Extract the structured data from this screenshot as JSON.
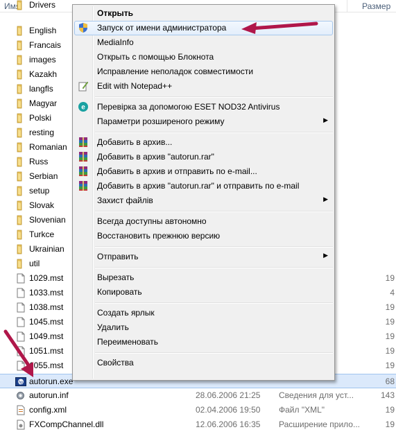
{
  "header": {
    "name_col": "Имя",
    "size_col": "Размер"
  },
  "files": [
    {
      "name": "Drivers",
      "kind": "folder",
      "date": "",
      "type": "",
      "size": ""
    },
    {
      "name": "English",
      "kind": "folder",
      "date": "",
      "type": "",
      "size": ""
    },
    {
      "name": "Francais",
      "kind": "folder",
      "date": "",
      "type": "",
      "size": ""
    },
    {
      "name": "images",
      "kind": "folder",
      "date": "",
      "type": "",
      "size": ""
    },
    {
      "name": "Kazakh",
      "kind": "folder",
      "date": "",
      "type": "",
      "size": ""
    },
    {
      "name": "langfls",
      "kind": "folder",
      "date": "",
      "type": "",
      "size": ""
    },
    {
      "name": "Magyar",
      "kind": "folder",
      "date": "",
      "type": "",
      "size": ""
    },
    {
      "name": "Polski",
      "kind": "folder",
      "date": "",
      "type": "",
      "size": ""
    },
    {
      "name": "resting",
      "kind": "folder",
      "date": "",
      "type": "",
      "size": ""
    },
    {
      "name": "Romanian",
      "kind": "folder",
      "date": "",
      "type": "",
      "size": ""
    },
    {
      "name": "Russ",
      "kind": "folder",
      "date": "",
      "type": "",
      "size": ""
    },
    {
      "name": "Serbian",
      "kind": "folder",
      "date": "",
      "type": "",
      "size": ""
    },
    {
      "name": "setup",
      "kind": "folder",
      "date": "",
      "type": "",
      "size": ""
    },
    {
      "name": "Slovak",
      "kind": "folder",
      "date": "",
      "type": "",
      "size": ""
    },
    {
      "name": "Slovenian",
      "kind": "folder",
      "date": "",
      "type": "",
      "size": ""
    },
    {
      "name": "Turkce",
      "kind": "folder",
      "date": "",
      "type": "",
      "size": ""
    },
    {
      "name": "Ukrainian",
      "kind": "folder",
      "date": "",
      "type": "",
      "size": ""
    },
    {
      "name": "util",
      "kind": "folder",
      "date": "",
      "type": "",
      "size": ""
    },
    {
      "name": "1029.mst",
      "kind": "file",
      "date": "",
      "type": "",
      "size": "19"
    },
    {
      "name": "1033.mst",
      "kind": "file",
      "date": "",
      "type": "",
      "size": "4"
    },
    {
      "name": "1038.mst",
      "kind": "file",
      "date": "",
      "type": "",
      "size": "19"
    },
    {
      "name": "1045.mst",
      "kind": "file",
      "date": "",
      "type": "",
      "size": "19"
    },
    {
      "name": "1049.mst",
      "kind": "file",
      "date": "",
      "type": "",
      "size": "19"
    },
    {
      "name": "1051.mst",
      "kind": "file",
      "date": "",
      "type": "",
      "size": "19"
    },
    {
      "name": "1055.mst",
      "kind": "file",
      "date": "",
      "type": "",
      "size": "19"
    },
    {
      "name": "autorun.exe",
      "kind": "exe",
      "date": "",
      "type": "",
      "size": "68",
      "selected": true
    },
    {
      "name": "autorun.inf",
      "kind": "inf",
      "date": "28.06.2006 21:25",
      "type": "Сведения для уст...",
      "size": "143"
    },
    {
      "name": "config.xml",
      "kind": "xml",
      "date": "02.04.2006 19:50",
      "type": "Файл \"XML\"",
      "size": "19"
    },
    {
      "name": "FXCompChannel.dll",
      "kind": "dll",
      "date": "12.06.2006 16:35",
      "type": "Расширение прило...",
      "size": "19"
    }
  ],
  "menu": {
    "items": [
      {
        "label": "Открыть",
        "icon": "",
        "bold": true,
        "sub": false
      },
      {
        "label": "Запуск от имени администратора",
        "icon": "uac-shield-icon",
        "bold": false,
        "sub": false,
        "highlight": true
      },
      {
        "label": "MediaInfo",
        "icon": "",
        "bold": false,
        "sub": false
      },
      {
        "label": "Открыть с помощью Блокнота",
        "icon": "",
        "bold": false,
        "sub": false
      },
      {
        "label": "Исправление неполадок совместимости",
        "icon": "",
        "bold": false,
        "sub": false
      },
      {
        "label": "Edit with Notepad++",
        "icon": "notepadpp-icon",
        "bold": false,
        "sub": false
      },
      {
        "sep": true
      },
      {
        "label": "Перевірка за допомогою ESET NOD32 Antivirus",
        "icon": "eset-icon",
        "bold": false,
        "sub": false
      },
      {
        "label": "Параметри розширеного режиму",
        "icon": "",
        "bold": false,
        "sub": true
      },
      {
        "sep": true
      },
      {
        "label": "Добавить в архив...",
        "icon": "winrar-icon",
        "bold": false,
        "sub": false
      },
      {
        "label": "Добавить в архив \"autorun.rar\"",
        "icon": "winrar-icon",
        "bold": false,
        "sub": false
      },
      {
        "label": "Добавить в архив и отправить по e-mail...",
        "icon": "winrar-icon",
        "bold": false,
        "sub": false
      },
      {
        "label": "Добавить в архив \"autorun.rar\" и отправить по e-mail",
        "icon": "winrar-icon",
        "bold": false,
        "sub": false
      },
      {
        "label": "Захист файлів",
        "icon": "",
        "bold": false,
        "sub": true
      },
      {
        "sep": true
      },
      {
        "label": "Всегда доступны автономно",
        "icon": "",
        "bold": false,
        "sub": false
      },
      {
        "label": "Восстановить прежнюю версию",
        "icon": "",
        "bold": false,
        "sub": false
      },
      {
        "sep": true
      },
      {
        "label": "Отправить",
        "icon": "",
        "bold": false,
        "sub": true
      },
      {
        "sep": true
      },
      {
        "label": "Вырезать",
        "icon": "",
        "bold": false,
        "sub": false
      },
      {
        "label": "Копировать",
        "icon": "",
        "bold": false,
        "sub": false
      },
      {
        "sep": true
      },
      {
        "label": "Создать ярлык",
        "icon": "",
        "bold": false,
        "sub": false
      },
      {
        "label": "Удалить",
        "icon": "",
        "bold": false,
        "sub": false
      },
      {
        "label": "Переименовать",
        "icon": "",
        "bold": false,
        "sub": false
      },
      {
        "sep": true
      },
      {
        "label": "Свойства",
        "icon": "",
        "bold": false,
        "sub": false
      }
    ]
  },
  "colors": {
    "annotation_arrow": "#b0174a",
    "folder": "#e8c15a",
    "selection": "#dbe9fb"
  }
}
